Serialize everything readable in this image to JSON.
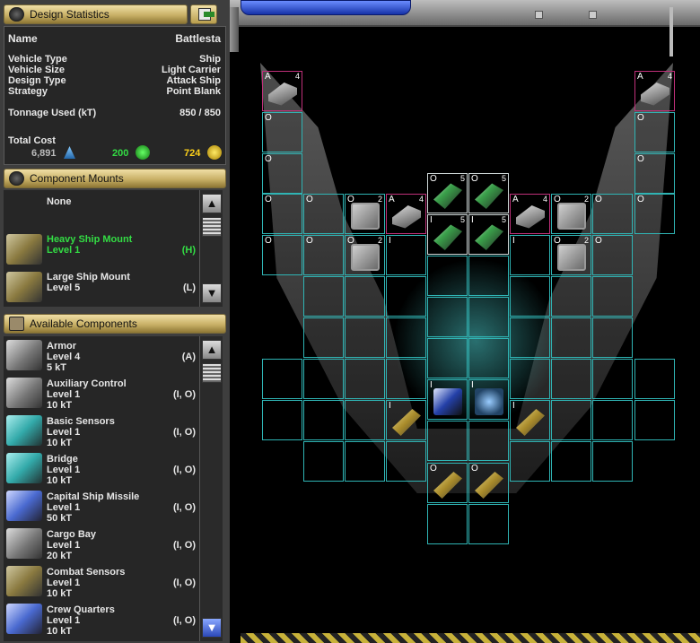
{
  "stats_panel": {
    "title": "Design Statistics",
    "name_label": "Name",
    "name_value": "Battlesta",
    "rows": [
      {
        "label": "Vehicle Type",
        "value": "Ship"
      },
      {
        "label": "Vehicle Size",
        "value": "Light Carrier"
      },
      {
        "label": "Design Type",
        "value": "Attack Ship"
      },
      {
        "label": "Strategy",
        "value": "Point Blank"
      }
    ],
    "tonnage_label": "Tonnage Used (kT)",
    "tonnage_value": "850 / 850",
    "cost_label": "Total Cost",
    "cost_minerals": "6,891",
    "cost_organics": "200",
    "cost_radioactives": "724"
  },
  "mounts_panel": {
    "title": "Component Mounts",
    "items": [
      {
        "name": "None",
        "level": "",
        "tag": "",
        "selected": false
      },
      {
        "name": "Heavy Ship Mount",
        "level": "Level 1",
        "tag": "(H)",
        "selected": true
      },
      {
        "name": "Large Ship Mount",
        "level": "Level 5",
        "tag": "(L)",
        "selected": false
      }
    ]
  },
  "components_panel": {
    "title": "Available Components",
    "items": [
      {
        "name": "Armor",
        "level": "Level 4",
        "size": "5 kT",
        "tag": "(A)"
      },
      {
        "name": "Auxiliary Control",
        "level": "Level 1",
        "size": "10 kT",
        "tag": "(I, O)"
      },
      {
        "name": "Basic Sensors",
        "level": "Level 1",
        "size": "10 kT",
        "tag": "(I, O)"
      },
      {
        "name": "Bridge",
        "level": "Level 1",
        "size": "10 kT",
        "tag": "(I, O)"
      },
      {
        "name": "Capital Ship Missile",
        "level": "Level 1",
        "size": "50 kT",
        "tag": "(I, O)"
      },
      {
        "name": "Cargo Bay",
        "level": "Level 1",
        "size": "20 kT",
        "tag": "(I, O)"
      },
      {
        "name": "Combat Sensors",
        "level": "Level 1",
        "size": "10 kT",
        "tag": "(I, O)"
      },
      {
        "name": "Crew Quarters",
        "level": "Level 1",
        "size": "10 kT",
        "tag": "(I, O)"
      }
    ]
  },
  "slots": [
    {
      "id": "a1",
      "label": "A",
      "stack": "4",
      "comp": "armor",
      "edge": "pink"
    },
    {
      "id": "a2",
      "label": "A",
      "stack": "4",
      "comp": "armor",
      "edge": "pink"
    },
    {
      "id": "o1",
      "label": "O",
      "stack": "",
      "comp": "",
      "edge": "teal"
    },
    {
      "id": "o2",
      "label": "O",
      "stack": "",
      "comp": "",
      "edge": "teal"
    },
    {
      "id": "o3",
      "label": "O",
      "stack": "",
      "comp": "",
      "edge": "teal"
    },
    {
      "id": "o4",
      "label": "O",
      "stack": "",
      "comp": "",
      "edge": "teal"
    },
    {
      "id": "o5",
      "label": "O",
      "stack": "",
      "comp": "",
      "edge": "teal"
    },
    {
      "id": "o6",
      "label": "O",
      "stack": "",
      "comp": "",
      "edge": "teal"
    },
    {
      "id": "o7",
      "label": "O",
      "stack": "",
      "comp": "",
      "edge": "teal"
    },
    {
      "id": "q1",
      "label": "O",
      "stack": "2",
      "comp": "quarters",
      "edge": "teal"
    },
    {
      "id": "a3",
      "label": "A",
      "stack": "4",
      "comp": "armor",
      "edge": "pink"
    },
    {
      "id": "h1",
      "label": "O",
      "stack": "5",
      "comp": "green",
      "edge": "white"
    },
    {
      "id": "h2",
      "label": "O",
      "stack": "5",
      "comp": "green",
      "edge": "white"
    },
    {
      "id": "a4",
      "label": "A",
      "stack": "4",
      "comp": "armor",
      "edge": "pink"
    },
    {
      "id": "q2",
      "label": "O",
      "stack": "2",
      "comp": "quarters",
      "edge": "teal"
    },
    {
      "id": "o8",
      "label": "O",
      "stack": "",
      "comp": "",
      "edge": "teal"
    },
    {
      "id": "o9",
      "label": "O",
      "stack": "",
      "comp": "",
      "edge": "teal"
    },
    {
      "id": "o10",
      "label": "O",
      "stack": "",
      "comp": "",
      "edge": "teal"
    },
    {
      "id": "q3",
      "label": "O",
      "stack": "2",
      "comp": "quarters",
      "edge": "teal"
    },
    {
      "id": "i1",
      "label": "I",
      "stack": "",
      "comp": "",
      "edge": "teal"
    },
    {
      "id": "h3",
      "label": "I",
      "stack": "5",
      "comp": "green",
      "edge": "white"
    },
    {
      "id": "h4",
      "label": "I",
      "stack": "5",
      "comp": "green",
      "edge": "white"
    },
    {
      "id": "i2",
      "label": "I",
      "stack": "",
      "comp": "",
      "edge": "teal"
    },
    {
      "id": "q4",
      "label": "O",
      "stack": "2",
      "comp": "quarters",
      "edge": "teal"
    },
    {
      "id": "o11",
      "label": "O",
      "stack": "",
      "comp": "",
      "edge": "teal"
    },
    {
      "id": "w1",
      "label": "I",
      "stack": "",
      "comp": "weapon",
      "edge": "teal"
    },
    {
      "id": "w2",
      "label": "I",
      "stack": "",
      "comp": "weapon",
      "edge": "teal"
    },
    {
      "id": "b1",
      "label": "I",
      "stack": "",
      "comp": "blue",
      "edge": "teal"
    },
    {
      "id": "b2",
      "label": "I",
      "stack": "",
      "comp": "cyan",
      "edge": "teal"
    },
    {
      "id": "w3",
      "label": "O",
      "stack": "",
      "comp": "weapon",
      "edge": "teal"
    },
    {
      "id": "w4",
      "label": "O",
      "stack": "",
      "comp": "weapon",
      "edge": "teal"
    }
  ]
}
